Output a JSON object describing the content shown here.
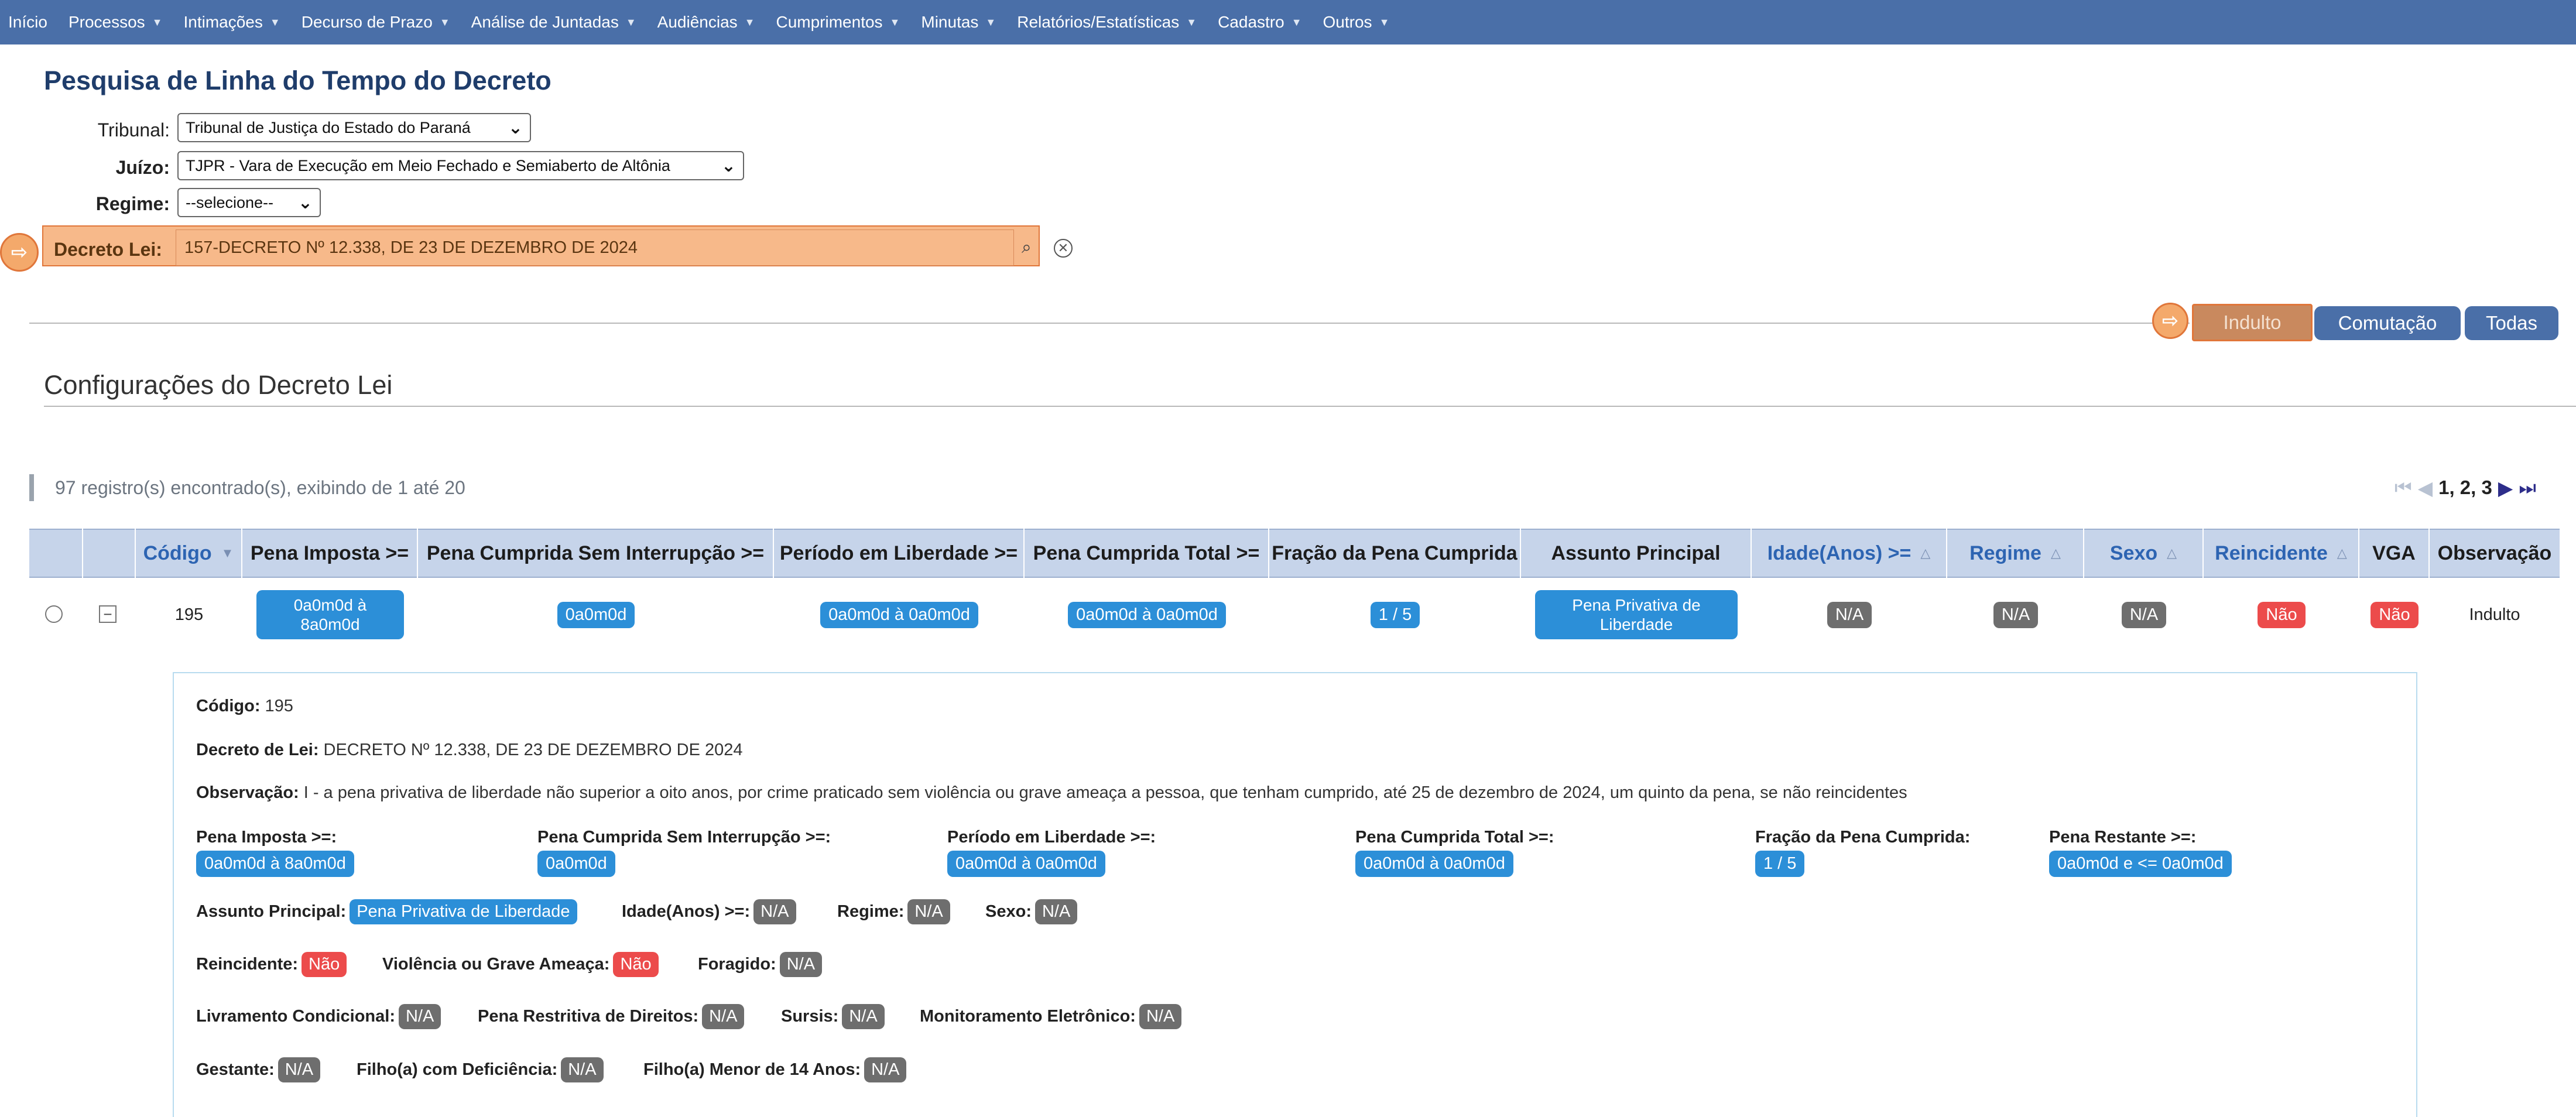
{
  "menu": [
    {
      "label": "Início",
      "has_dropdown": false
    },
    {
      "label": "Processos",
      "has_dropdown": true
    },
    {
      "label": "Intimações",
      "has_dropdown": true
    },
    {
      "label": "Decurso de Prazo",
      "has_dropdown": true
    },
    {
      "label": "Análise de Juntadas",
      "has_dropdown": true
    },
    {
      "label": "Audiências",
      "has_dropdown": true
    },
    {
      "label": "Cumprimentos",
      "has_dropdown": true
    },
    {
      "label": "Minutas",
      "has_dropdown": true
    },
    {
      "label": "Relatórios/Estatísticas",
      "has_dropdown": true
    },
    {
      "label": "Cadastro",
      "has_dropdown": true
    },
    {
      "label": "Outros",
      "has_dropdown": true
    }
  ],
  "page_title": "Pesquisa de Linha do Tempo do Decreto",
  "form": {
    "tribunal_label": "Tribunal:",
    "tribunal_value": "Tribunal de Justiça do Estado do Paraná",
    "juizo_label": "Juízo:",
    "juizo_value": "TJPR - Vara de Execução em Meio Fechado e Semiaberto de Altônia",
    "regime_label": "Regime:",
    "regime_value": "--selecione--",
    "decreto_label": "Decreto Lei:",
    "decreto_value": "157-DECRETO Nº 12.338, DE 23 DE DEZEMBRO DE 2024"
  },
  "filters": {
    "indulto": "Indulto",
    "comutacao": "Comutação",
    "todas": "Todas"
  },
  "section_title": "Configurações do Decreto Lei",
  "records_text": "97 registro(s) encontrado(s), exibindo de 1 até 20",
  "pagination": "1, 2, 3",
  "table": {
    "headers": {
      "codigo": "Código",
      "pena_imposta": "Pena Imposta >=",
      "pena_cumprida_sem": "Pena Cumprida Sem Interrupção >=",
      "periodo_liberdade": "Período em Liberdade >=",
      "pena_cumprida_total": "Pena Cumprida Total >=",
      "fracao": "Fração da Pena Cumprida",
      "assunto": "Assunto Principal",
      "idade": "Idade(Anos) >=",
      "regime": "Regime",
      "sexo": "Sexo",
      "reincidente": "Reincidente",
      "vga": "VGA",
      "observacao": "Observação"
    },
    "row": {
      "codigo": "195",
      "pena_imposta": "0a0m0d à 8a0m0d",
      "pena_cumprida_sem": "0a0m0d",
      "periodo_liberdade": "0a0m0d à 0a0m0d",
      "pena_cumprida_total": "0a0m0d à 0a0m0d",
      "fracao": "1 / 5",
      "assunto": "Pena Privativa de Liberdade",
      "idade": "N/A",
      "regime": "N/A",
      "sexo": "N/A",
      "reincidente": "Não",
      "vga": "Não",
      "observacao": "Indulto"
    }
  },
  "detail": {
    "codigo_label": "Código:",
    "codigo": "195",
    "decreto_label": "Decreto de Lei:",
    "decreto": "DECRETO Nº 12.338, DE 23 DE DEZEMBRO DE 2024",
    "observacao_label": "Observação:",
    "observacao": "I - a pena privativa de liberdade não superior a oito anos, por crime praticado sem violência ou grave ameaça a pessoa, que tenham cumprido, até 25 de dezembro de 2024, um quinto da pena, se não reincidentes",
    "pena_imposta_label": "Pena Imposta >=:",
    "pena_imposta": "0a0m0d à 8a0m0d",
    "pena_cumprida_sem_label": "Pena Cumprida Sem Interrupção >=:",
    "pena_cumprida_sem": "0a0m0d",
    "periodo_label": "Período em Liberdade >=:",
    "periodo": "0a0m0d à 0a0m0d",
    "pena_total_label": "Pena Cumprida Total >=:",
    "pena_total": "0a0m0d à 0a0m0d",
    "fracao_label": "Fração da Pena Cumprida:",
    "fracao": "1 / 5",
    "pena_restante_label": "Pena Restante >=:",
    "pena_restante": "0a0m0d e <= 0a0m0d",
    "assunto_label": "Assunto Principal:",
    "assunto": "Pena Privativa de Liberdade",
    "idade_label": "Idade(Anos) >=:",
    "idade": "N/A",
    "regime_label": "Regime:",
    "regime": "N/A",
    "sexo_label": "Sexo:",
    "sexo": "N/A",
    "reincidente_label": "Reincidente:",
    "reincidente": "Não",
    "violencia_label": "Violência ou Grave Ameaça:",
    "violencia": "Não",
    "foragido_label": "Foragido:",
    "foragido": "N/A",
    "livramento_label": "Livramento Condicional:",
    "livramento": "N/A",
    "restritiva_label": "Pena Restritiva de Direitos:",
    "restritiva": "N/A",
    "sursis_label": "Sursis:",
    "sursis": "N/A",
    "monitoramento_label": "Monitoramento Eletrônico:",
    "monitoramento": "N/A",
    "gestante_label": "Gestante:",
    "gestante": "N/A",
    "filho_def_label": "Filho(a) com Deficiência:",
    "filho_def": "N/A",
    "filho_menor_label": "Filho(a) Menor de 14 Anos:",
    "filho_menor": "N/A"
  },
  "colors": {
    "menu_bg": "#4a6fa8",
    "highlight": "#f7b98a",
    "pill_blue": "#2c8fd8",
    "pill_gray": "#6e6e6e",
    "pill_red": "#ec4b4b"
  }
}
